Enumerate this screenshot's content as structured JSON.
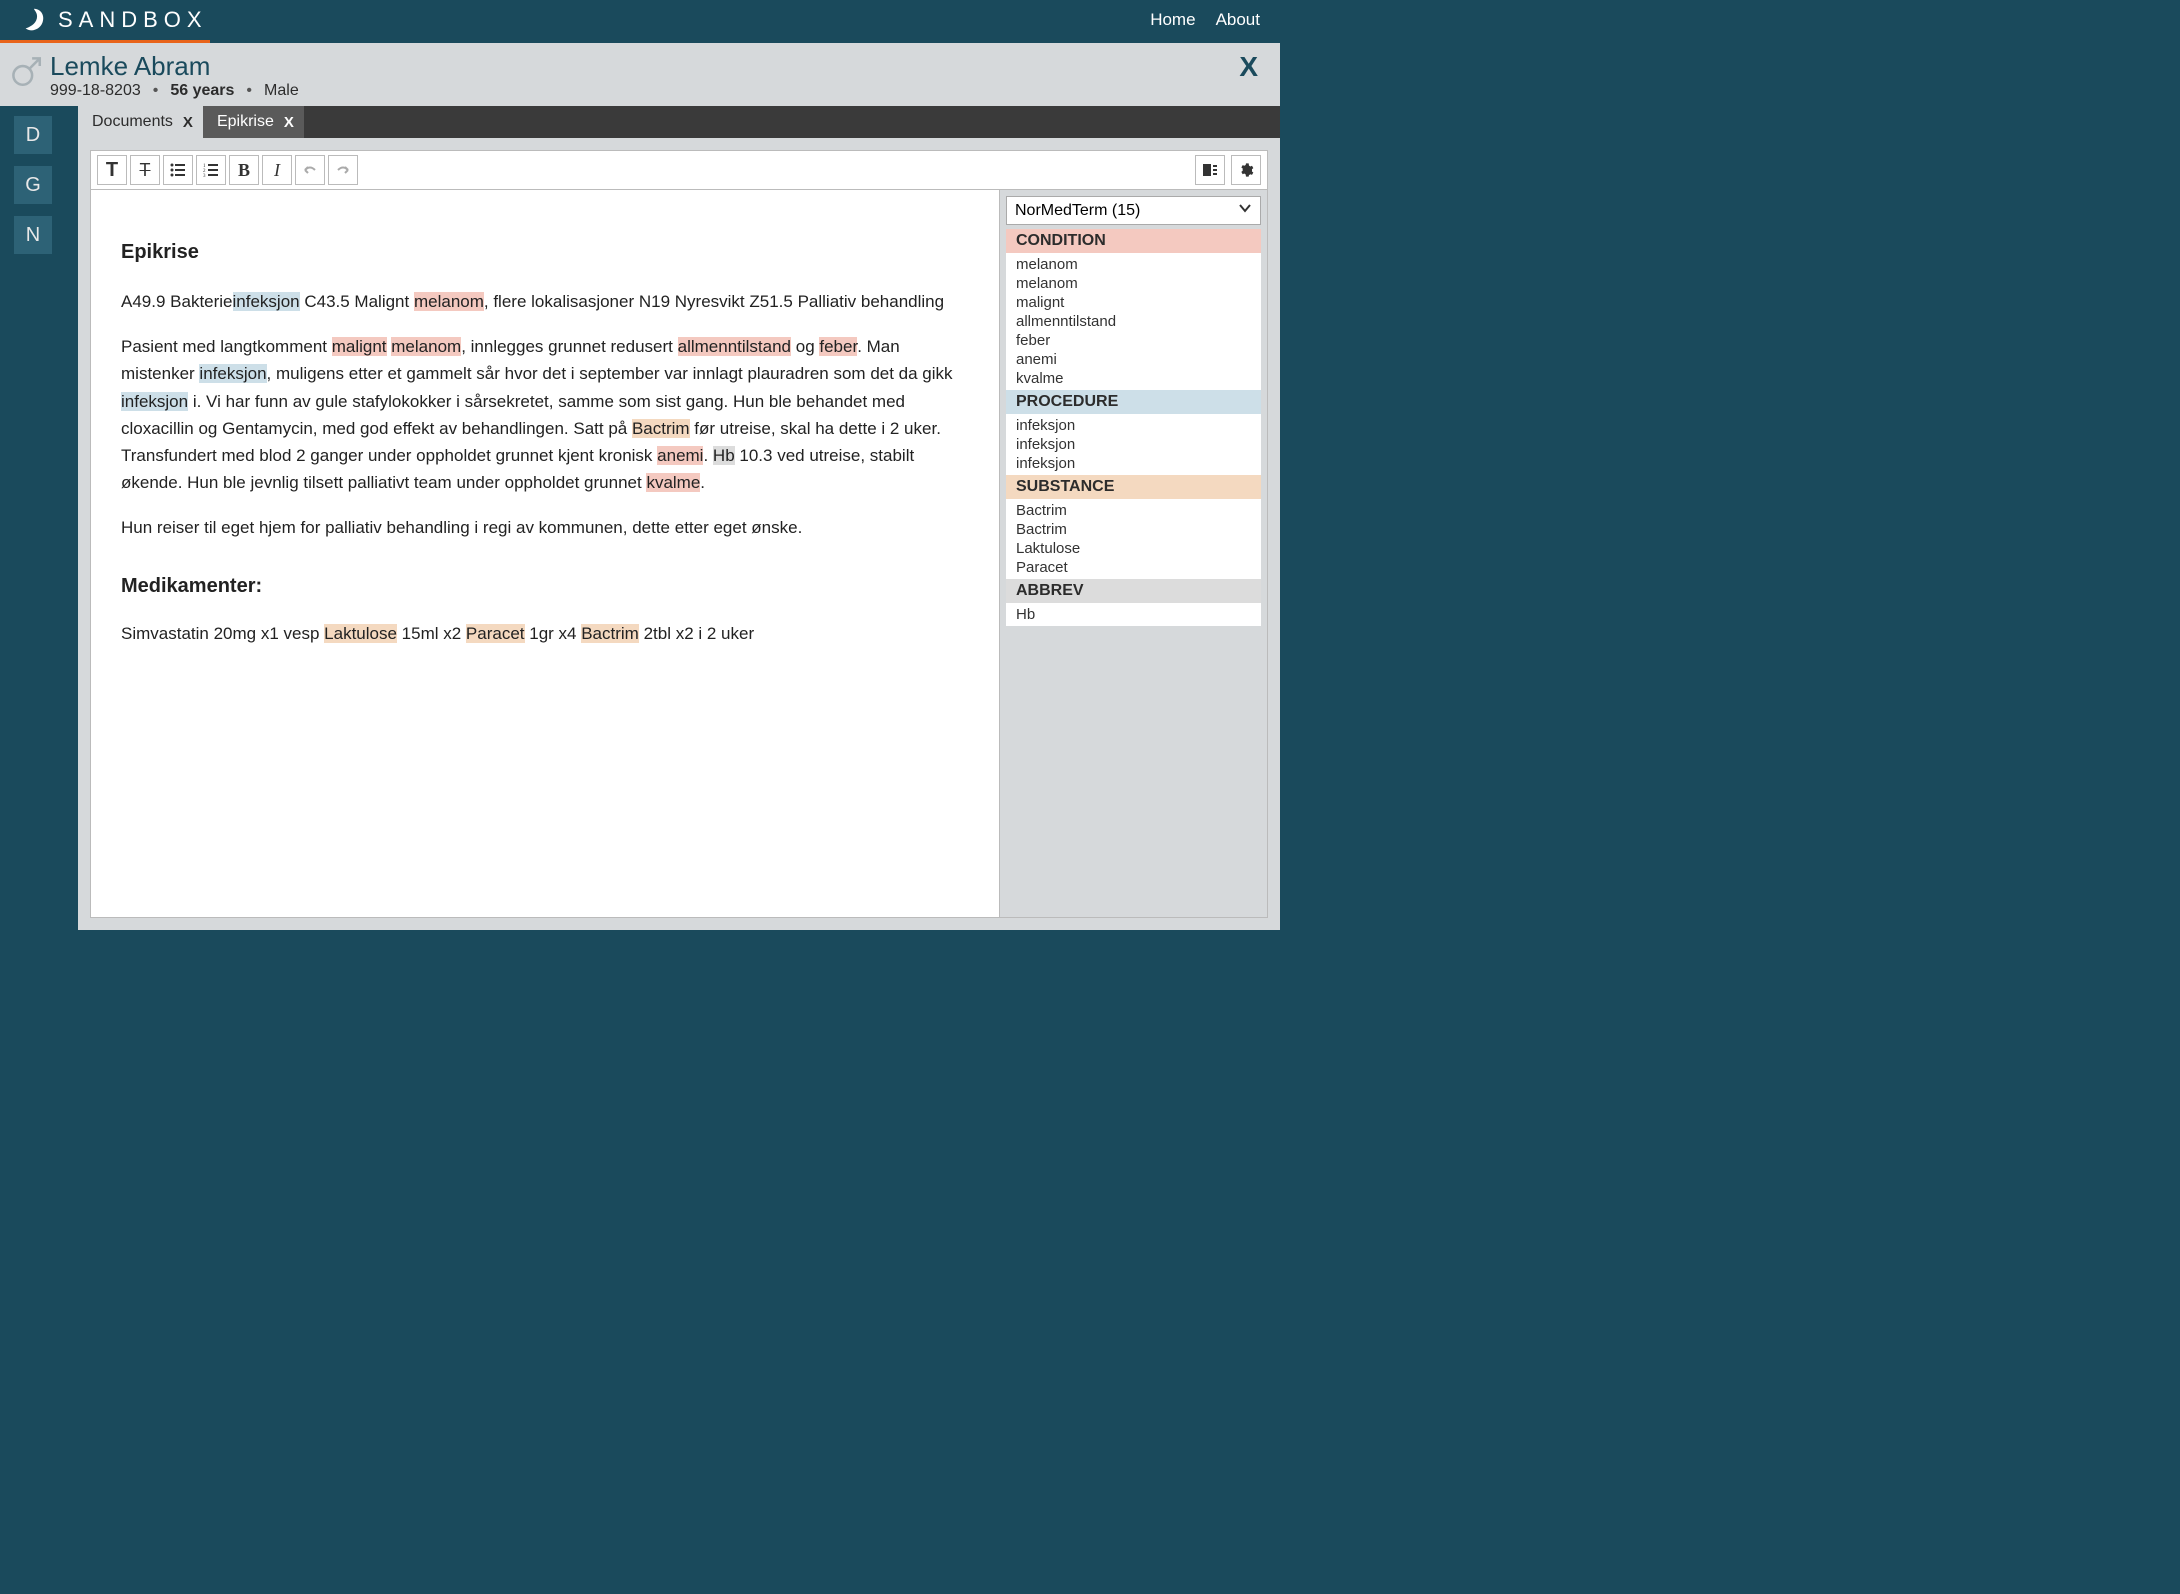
{
  "brand": "SANDBOX",
  "nav": {
    "home": "Home",
    "about": "About"
  },
  "patient": {
    "name": "Lemke Abram",
    "id": "999-18-8203",
    "age": "56 years",
    "gender": "Male"
  },
  "leftRail": [
    "D",
    "G",
    "N"
  ],
  "tabs": [
    {
      "label": "Documents",
      "active": false
    },
    {
      "label": "Epikrise",
      "active": true
    }
  ],
  "document": {
    "title": "Epikrise",
    "p1_pre": "A49.9 Bakterie",
    "p1_hl1": "infeksjon",
    "p1_mid1": " C43.5 Malignt ",
    "p1_hl2": "melanom",
    "p1_post": ", flere lokalisasjoner N19 Nyresvikt Z51.5 Palliativ behandling",
    "p2_a": "Pasient med langtkomment ",
    "p2_hl1": "malignt",
    "p2_sp": " ",
    "p2_hl2": "melanom",
    "p2_b": ", innlegges grunnet redusert ",
    "p2_hl3": "allmenntilstand",
    "p2_c": " og ",
    "p2_hl4": "feber",
    "p2_d": ". Man mistenker ",
    "p2_hl5": "infeksjon",
    "p2_e": ", muligens etter et gammelt sår hvor det i september var innlagt plauradren som det da gikk ",
    "p2_hl6": "infeksjon",
    "p2_f": " i. Vi har funn av gule stafylokokker i sårsekretet, samme som sist gang. Hun ble behandet med cloxacillin og Gentamycin, med god effekt av behandlingen. Satt på ",
    "p2_hl7": "Bactrim",
    "p2_g": " før utreise, skal ha dette i 2 uker. Transfundert med blod 2 ganger under oppholdet grunnet kjent kronisk ",
    "p2_hl8": "anemi",
    "p2_h": ". ",
    "p2_hl9": "Hb",
    "p2_i": " 10.3 ved utreise, stabilt økende. Hun ble jevnlig tilsett palliativt team under oppholdet grunnet ",
    "p2_hl10": "kvalme",
    "p2_j": ".",
    "p3": "Hun reiser til eget hjem for palliativ behandling i regi av kommunen, dette etter eget ønske.",
    "medHeading": "Medikamenter:",
    "p4_a": "Simvastatin 20mg x1 vesp ",
    "p4_hl1": "Laktulose",
    "p4_b": " 15ml x2 ",
    "p4_hl2": "Paracet",
    "p4_c": " 1gr x4 ",
    "p4_hl3": "Bactrim",
    "p4_d": " 2tbl x2 i 2 uker"
  },
  "panel": {
    "dropdown": "NorMedTerm (15)",
    "categories": [
      {
        "name": "CONDITION",
        "class": "cat-condition",
        "items": [
          "melanom",
          "melanom",
          "malignt",
          "allmenntilstand",
          "feber",
          "anemi",
          "kvalme"
        ]
      },
      {
        "name": "PROCEDURE",
        "class": "cat-procedure",
        "items": [
          "infeksjon",
          "infeksjon",
          "infeksjon"
        ]
      },
      {
        "name": "SUBSTANCE",
        "class": "cat-substance",
        "items": [
          "Bactrim",
          "Bactrim",
          "Laktulose",
          "Paracet"
        ]
      },
      {
        "name": "ABBREV",
        "class": "cat-abbrev",
        "items": [
          "Hb"
        ]
      }
    ]
  }
}
